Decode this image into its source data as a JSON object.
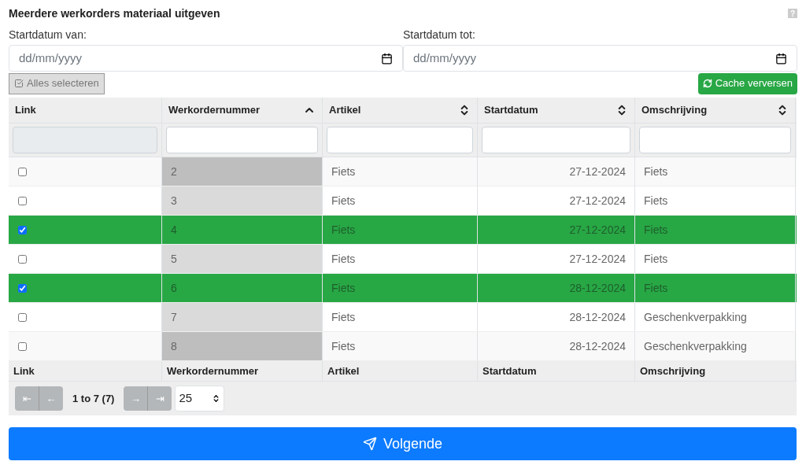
{
  "title": "Meerdere werkorders materiaal uitgeven",
  "help": "?",
  "date_from": {
    "label": "Startdatum van:",
    "placeholder": "dd/mm/yyyy"
  },
  "date_to": {
    "label": "Startdatum tot:",
    "placeholder": "dd/mm/yyyy"
  },
  "select_all": {
    "label": "Alles selecteren",
    "disabled": true
  },
  "refresh": {
    "label": "Cache verversen"
  },
  "columns": [
    {
      "label": "Link",
      "sortable": false,
      "filter_disabled": true
    },
    {
      "label": "Werkordernummer",
      "sortable": true,
      "sorted": true,
      "filter_disabled": false
    },
    {
      "label": "Artikel",
      "sortable": true,
      "sorted": false,
      "filter_disabled": false
    },
    {
      "label": "Startdatum",
      "sortable": true,
      "sorted": false,
      "filter_disabled": false
    },
    {
      "label": "Omschrijving",
      "sortable": true,
      "sorted": false,
      "filter_disabled": false
    }
  ],
  "rows": [
    {
      "selected": false,
      "cells": [
        "2",
        "Fiets",
        "27-12-2024",
        "Fiets"
      ]
    },
    {
      "selected": false,
      "cells": [
        "3",
        "Fiets",
        "27-12-2024",
        "Fiets"
      ]
    },
    {
      "selected": true,
      "cells": [
        "4",
        "Fiets",
        "27-12-2024",
        "Fiets"
      ]
    },
    {
      "selected": false,
      "cells": [
        "5",
        "Fiets",
        "27-12-2024",
        "Fiets"
      ]
    },
    {
      "selected": true,
      "cells": [
        "6",
        "Fiets",
        "28-12-2024",
        "Fiets"
      ]
    },
    {
      "selected": false,
      "cells": [
        "7",
        "Fiets",
        "28-12-2024",
        "Geschenkverpakking"
      ]
    },
    {
      "selected": false,
      "cells": [
        "8",
        "Fiets",
        "28-12-2024",
        "Geschenkverpakking"
      ]
    }
  ],
  "footer_columns": [
    "Link",
    "Werkordernummer",
    "Artikel",
    "Startdatum",
    "Omschrijving"
  ],
  "pagination": {
    "first": "⇤",
    "prev": "←",
    "range": "1 to 7 (7)",
    "next": "→",
    "last": "⇥",
    "disabled": true,
    "page_size": "25"
  },
  "submit": {
    "label": "Volgende"
  }
}
